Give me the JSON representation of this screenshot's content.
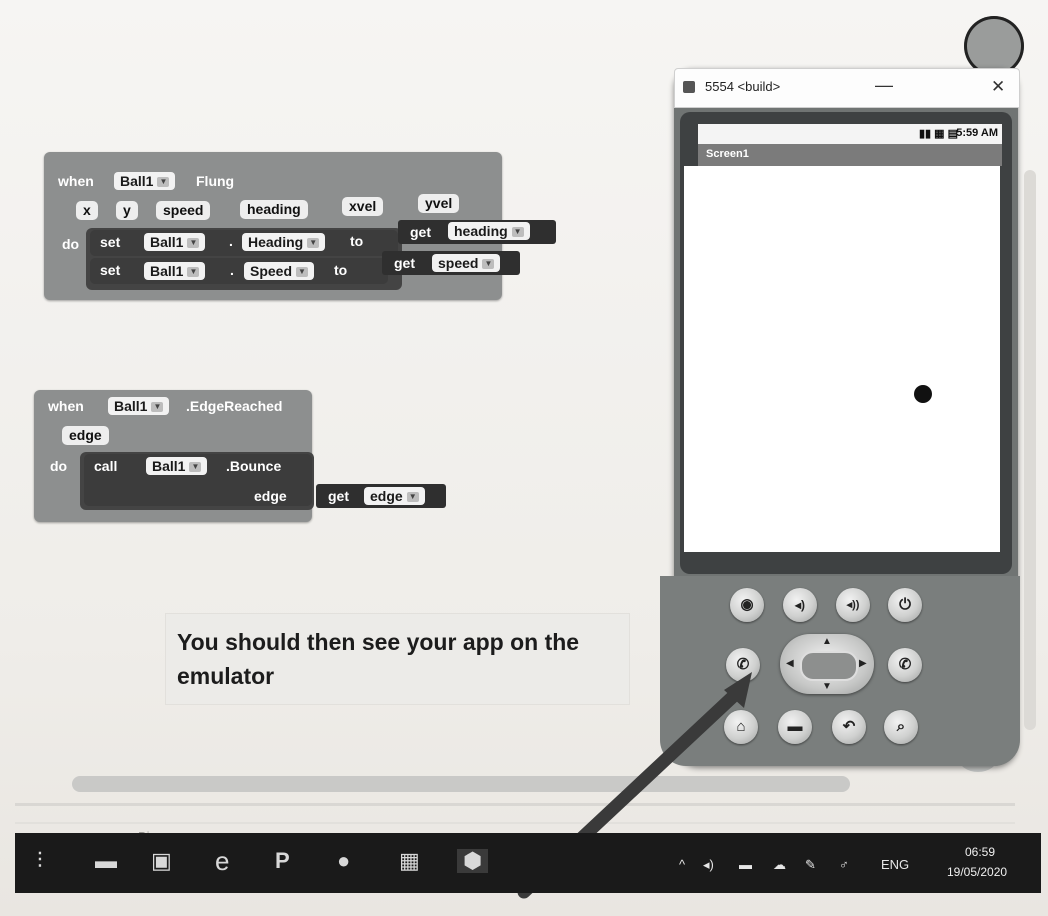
{
  "block_fling": {
    "when": "when",
    "component": "Ball1",
    "event": "Flung",
    "params": [
      "x",
      "y",
      "speed",
      "heading",
      "xvel",
      "yvel"
    ],
    "do": "do",
    "row1": {
      "set": "set",
      "component": "Ball1",
      "dot": ".",
      "property": "Heading",
      "to": "to",
      "get": "get",
      "var": "heading"
    },
    "row2": {
      "set": "set",
      "component": "Ball1",
      "dot": ".",
      "property": "Speed",
      "to": "to",
      "get": "get",
      "var": "speed"
    }
  },
  "block_edge": {
    "when": "when",
    "component": "Ball1",
    "event": ".EdgeReached",
    "param": "edge",
    "do": "do",
    "call": "call",
    "call_component": "Ball1",
    "method": ".Bounce",
    "arg_label": "edge",
    "get": "get",
    "var": "edge"
  },
  "caption": "You should then see your app on the emulator",
  "faint_text": "Bi... ...e... ...",
  "emulator": {
    "title": "5554 <build>",
    "min": "—",
    "close": "✕",
    "status_icons": "▮▮ ▦ ▤",
    "status_time": "5:59 AM",
    "screen_title": "Screen1"
  },
  "keypad_icons": {
    "camera": "◉",
    "vol_down": "◂)",
    "vol_up": "◂))",
    "power": "⏻",
    "call": "✆",
    "end": "✆",
    "home": "⌂",
    "menu": "▬",
    "back": "↶",
    "search": "⌕"
  },
  "taskbar": {
    "task_view": "⫶",
    "explorer": "▬",
    "store": "▣",
    "edge": "e",
    "ppt": "P",
    "app5": "●",
    "app6": "▦",
    "app7": "⬢",
    "tray": [
      "^",
      "◂)",
      "▬",
      "☁",
      "✎",
      "♂",
      "ENG"
    ],
    "time": "06:59",
    "date": "19/05/2020"
  },
  "colors": {
    "block_bg": "#8d8f8f",
    "setter_bg": "#3c3c3c",
    "taskbar_bg": "#1a1a1a"
  }
}
